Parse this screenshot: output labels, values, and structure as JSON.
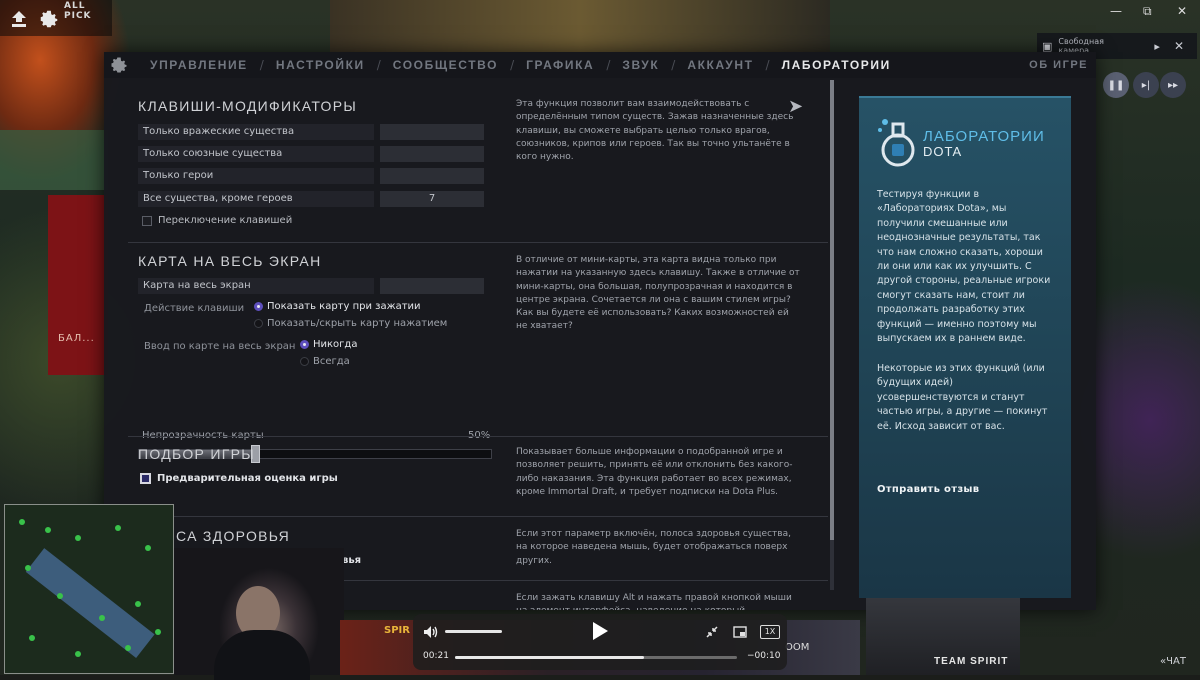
{
  "hud": {
    "mode": "ALL PICK",
    "camera_label": "Свободная камера",
    "bg_red_text": "БАЛ..."
  },
  "tabs": [
    {
      "label": "Управление"
    },
    {
      "label": "Настройки"
    },
    {
      "label": "Сообщество"
    },
    {
      "label": "Графика"
    },
    {
      "label": "Звук"
    },
    {
      "label": "Аккаунт"
    },
    {
      "label": "Лаборатории"
    }
  ],
  "about_label": "Об игре",
  "modifiers": {
    "title": "Клавиши-модификаторы",
    "rows": [
      {
        "name": "Только вражеские существа",
        "key": ""
      },
      {
        "name": "Только союзные существа",
        "key": ""
      },
      {
        "name": "Только герои",
        "key": ""
      },
      {
        "name": "Все существа, кроме героев",
        "key": "7"
      }
    ],
    "toggle_label": "Переключение клавишей",
    "description": "Эта функция позволит вам взаимодействовать с определённым типом существ. Зажав назначенные здесь клавиши, вы сможете выбрать целью только врагов, союзников, крипов или героев. Так вы точно ультанёте в кого нужно."
  },
  "fullmap": {
    "title": "Карта на весь экран",
    "key_label": "Карта на весь экран",
    "key_value": "",
    "action_label": "Действие клавиши",
    "action_options": [
      "Показать карту при зажатии",
      "Показать/скрыть карту нажатием"
    ],
    "input_label": "Ввод по карте на весь экран",
    "input_options": [
      "Никогда",
      "Всегда"
    ],
    "opacity_label": "Непрозрачность карты",
    "opacity_value": "50%",
    "opacity_fraction": 0.33,
    "description": "В отличие от мини-карты, эта карта видна только при нажатии на указанную здесь клавишу. Также в отличие от мини-карты, она большая, полупрозрачная и находится в центре экрана. Сочетается ли она с вашим стилем игры? Как вы будете её использовать? Каких возможностей ей не хватает?"
  },
  "matchmaking": {
    "title": "Подбор игры",
    "checkbox_label": "Предварительная оценка игры",
    "description": "Показывает больше информации о подобранной игре и позволяет решить, принять её или отклонить без какого-либо наказания. Эта функция работает во всех режимах, кроме Immortal Draft, и требует подписки на Dota Plus."
  },
  "healthbar": {
    "title": "…лоса здоровья",
    "checkbox_label": "…ровья",
    "description": "Если этот параметр включён, полоса здоровья существа, на которое наведена мышь, будет отображаться поверх других."
  },
  "altclick": {
    "description": "Если зажать клавишу Alt и нажать правой кнопкой мыши на элемент интерфейса, наведение на который показывает"
  },
  "card": {
    "title_line1": "ЛАБОРАТОРИИ",
    "title_line2": "DOTA",
    "paragraph1": "Тестируя функции в «Лабораториях Dota», мы получили смешанные или неоднозначные результаты, так что нам сложно сказать, хороши ли они или как их улучшить. С другой стороны, реальные игроки смогут сказать нам, стоит ли продолжать разработку этих функций — именно поэтому мы выпускаем их в раннем виде.",
    "paragraph2": "Некоторые из этих функций (или будущих идей) усовершенствуются и станут частью игры, а другие — покинут её. Исход зависит от вас.",
    "feedback_link": "Отправить отзыв"
  },
  "overlays": {
    "spirit_banner": "SPIR",
    "team_name": "TEAM SPIRIT",
    "chat_label": "«ЧАТ",
    "room_label": "OOM"
  },
  "player": {
    "time_elapsed": "00:21",
    "time_remaining": "−00:10",
    "progress": 0.67,
    "volume": 0.95,
    "speed": "1X"
  },
  "colors": {
    "accent_purple": "#5e4fbd",
    "lab_blue": "#5fbde8",
    "card_bg": "#265266"
  }
}
